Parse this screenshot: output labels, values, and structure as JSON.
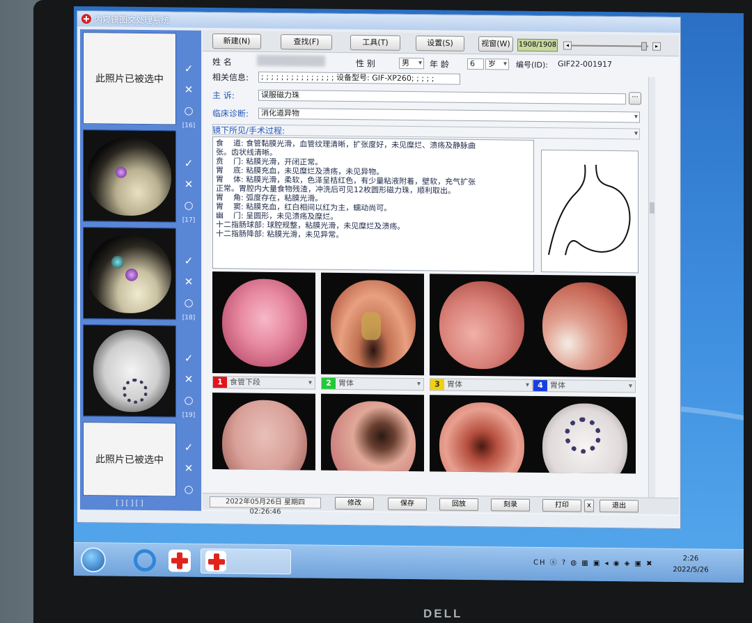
{
  "window_title": "内窥镜图文处理系统",
  "thumbnails": {
    "selected_text": "此照片已被选中",
    "controls": [
      "✓",
      "✕",
      "○"
    ],
    "numbers": [
      "[16]",
      "[17]",
      "[18]",
      "[19]"
    ],
    "footer": "[ ]  [ ]  [ ]"
  },
  "toolbar": {
    "new": "新建(N)",
    "search": "查找(F)",
    "tools": "工具(T)",
    "settings": "设置(S)",
    "view": "视窗(W)",
    "page": "1908/1908"
  },
  "patient": {
    "name_label": "姓    名",
    "gender_label": "性    别",
    "gender": "男",
    "age_label": "年    龄",
    "age": "6",
    "age_unit": "岁",
    "id_label": "编号(ID):",
    "id": "GIF22-001917",
    "info_label": "相关信息:",
    "info_value": "; ; ; ; ; ; ; ; ; ; ; ; ; ; ; 设备型号: GIF-XP260; ; ; ; ;"
  },
  "complaint": {
    "label": "主    诉:",
    "value": "误服磁力珠"
  },
  "diagnosis": {
    "label": "临床诊断:",
    "value": "消化道异物"
  },
  "findings_label": "镜下所见/手术过程:",
  "findings_lines": [
    "食    道: 食管黏膜光滑，血管纹理清晰，扩张度好，未见糜烂、溃疡及静脉曲",
    "张。齿状线清晰。",
    "贲    门: 粘膜光滑，开闭正常。",
    "胃    底: 粘膜充血，未见糜烂及溃疡，未见异物。",
    "胃    体: 粘膜光滑，柔软，色泽呈桔红色，有少量粘液附着，壁软，充气扩张",
    "正常。胃腔内大量食物残渣，冲洗后可见12枚圆形磁力珠，顺利取出。",
    "胃    角: 弧度存在，粘膜光滑。",
    "胃    窦: 粘膜充血，红白相间以红为主，蠕动尚可。",
    "幽    门: 呈圆形，未见溃疡及糜烂。",
    "十二指肠球部: 球腔规整，粘膜光滑，未见糜烂及溃疡。",
    "十二指肠降部: 粘膜光滑，未见异常。"
  ],
  "images": [
    {
      "num": "1",
      "label": "食管下段",
      "color": "#e0141c"
    },
    {
      "num": "2",
      "label": "胃体",
      "color": "#25c83a"
    },
    {
      "num": "3",
      "label": "胃体",
      "color": "#f0d010"
    },
    {
      "num": "4",
      "label": "胃体",
      "color": "#1a3fe0"
    }
  ],
  "status": {
    "datetime": "2022年05月26日 星期四 02:26:46",
    "edit": "修改",
    "save": "保存",
    "back": "回放",
    "record": "刻录",
    "print": "打印",
    "close_x": "x",
    "exit": "退出"
  },
  "taskbar": {
    "tray": "CH ⓢ ? ◍ ▦ ▣ ◂ ◉ ◈ ▣ ✖",
    "time": "2:26",
    "date": "2022/5/26"
  },
  "brand": "DELL"
}
